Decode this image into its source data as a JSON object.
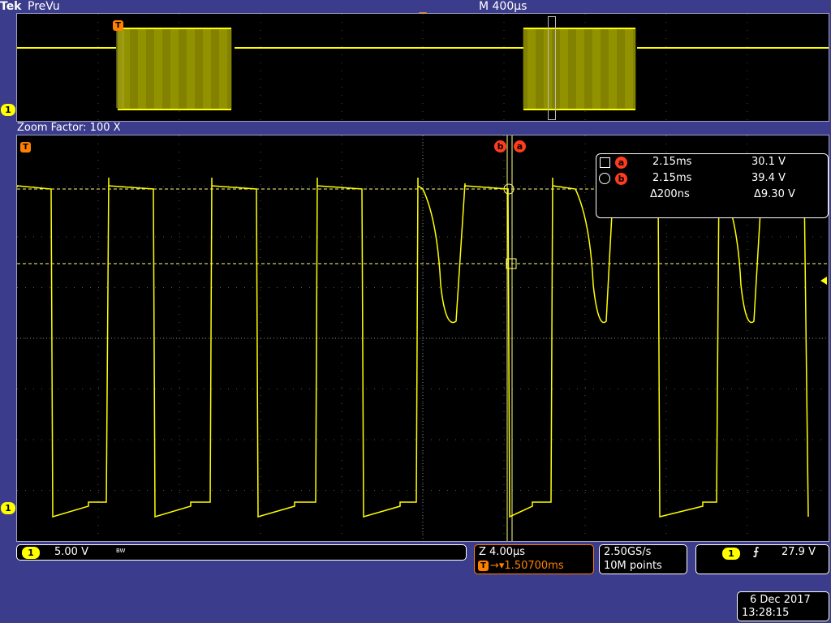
{
  "header": {
    "brand": "Tek",
    "mode": "PreVu",
    "timebase": "M 400µs"
  },
  "zoom": {
    "label": "Zoom Factor: 100 X"
  },
  "channel": {
    "id": "1",
    "scale": "5.00 V",
    "bw_symbol": "BW",
    "color": "#ffff00"
  },
  "cursors": {
    "a_label": "a",
    "b_label": "b",
    "a_time": "2.15ms",
    "a_value": "30.1 V",
    "b_time": "2.15ms",
    "b_value": "39.4 V",
    "delta_time": "Δ200ns",
    "delta_value": "Δ9.30 V"
  },
  "trigger_marker": "T",
  "zoom_info": {
    "zoom_scale": "Z 4.00µs",
    "trigger_pos": "→▾1.50700ms"
  },
  "acquisition": {
    "sample_rate": "2.50GS/s",
    "record_length": "10M points"
  },
  "trigger": {
    "source": "1",
    "slope_symbol": "⨍",
    "level": "27.9 V"
  },
  "datetime": {
    "date": "6 Dec 2017",
    "time": "13:28:15"
  },
  "colors": {
    "background": "#3c3c8c",
    "trace": "#ffff00",
    "trigger": "#ff8000",
    "cursor": "#ff3c1e"
  }
}
